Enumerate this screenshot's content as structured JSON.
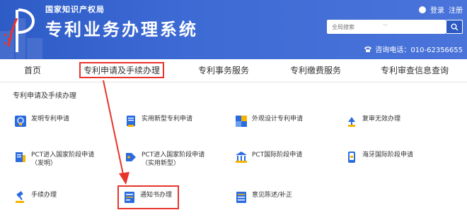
{
  "header": {
    "agency": "国家知识产权局",
    "title": "专利业务办理系统",
    "login": "登录",
    "register": "注册",
    "search_placeholder": "全局搜索",
    "hotline": "咨询电话：010-62356655"
  },
  "nav": {
    "items": [
      {
        "label": "首页"
      },
      {
        "label": "专利申请及手续办理"
      },
      {
        "label": "专利事务服务"
      },
      {
        "label": "专利缴费服务"
      },
      {
        "label": "专利审查信息查询"
      }
    ],
    "active_index": 1
  },
  "section": {
    "title": "专利申请及手续办理"
  },
  "services": [
    {
      "label": "发明专利申请",
      "icon": "lightbulb-gear-icon"
    },
    {
      "label": "实用新型专利申请",
      "icon": "document-icon"
    },
    {
      "label": "外观设计专利申请",
      "icon": "puzzle-icon"
    },
    {
      "label": "复审无效办理",
      "icon": "lamp-icon"
    },
    {
      "label": "PCT进入国家阶段申请",
      "label2": "（发明）",
      "icon": "pct-book-icon"
    },
    {
      "label": "PCT进入国家阶段申请",
      "label2": "（实用新型）",
      "icon": "pct-tag-icon"
    },
    {
      "label": "PCT国际阶段申请",
      "icon": "building-icon"
    },
    {
      "label": "海牙国际阶段申请",
      "icon": "phone-doc-icon"
    },
    {
      "label": "手续办理",
      "icon": "gavel-icon"
    },
    {
      "label": "通知书办理",
      "icon": "notice-doc-icon"
    },
    {
      "label": "意见陈述/补正",
      "icon": "form-doc-icon"
    }
  ],
  "colors": {
    "header_blue": "#3d6ad4",
    "highlight_red": "#e8342c",
    "icon_blue": "#2b6be0",
    "icon_yellow": "#f5b400"
  }
}
